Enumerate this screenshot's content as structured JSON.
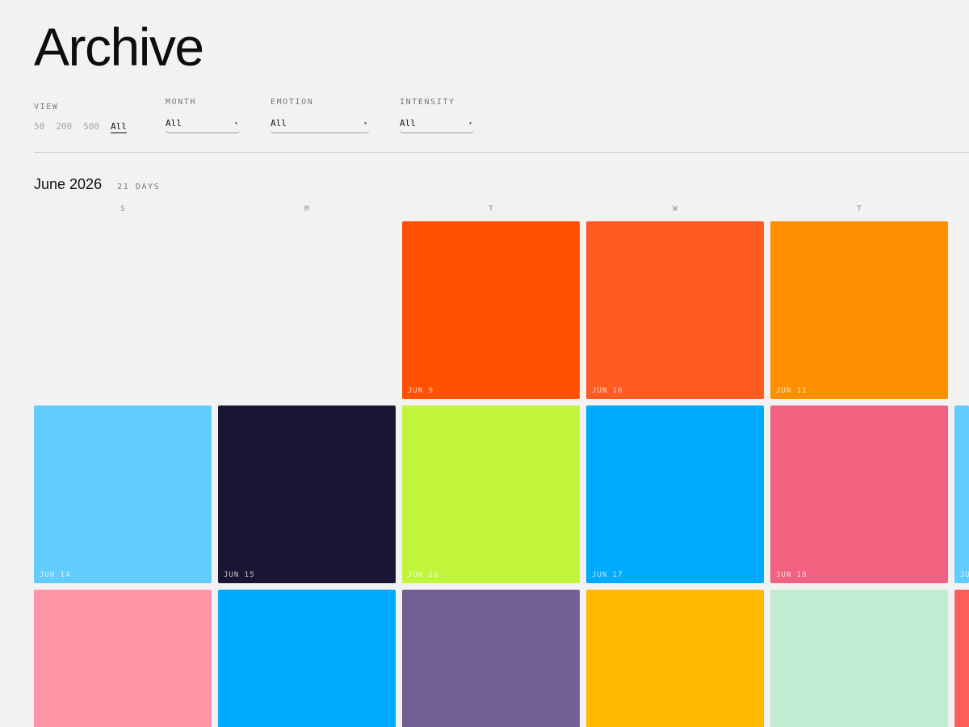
{
  "page": {
    "title": "Archive"
  },
  "filters": {
    "view": {
      "label": "VIEW",
      "options": [
        "50",
        "200",
        "500",
        "All"
      ],
      "selected": "All"
    },
    "month": {
      "label": "MONTH",
      "value": "All"
    },
    "emotion": {
      "label": "EMOTION",
      "value": "All"
    },
    "intensity": {
      "label": "INTENSITY",
      "value": "All"
    }
  },
  "calendar": {
    "month_title": "June 2026",
    "day_count": "21 DAYS",
    "weekdays": [
      "S",
      "M",
      "T",
      "W",
      "T"
    ],
    "tiles": [
      {
        "date": "JUN 9",
        "color": "#ff5100"
      },
      {
        "date": "JUN 10",
        "color": "#ff5a20"
      },
      {
        "date": "JUN 11",
        "color": "#ff8f00"
      },
      {
        "date": "JUN 14",
        "color": "#62ccff"
      },
      {
        "date": "JUN 15",
        "color": "#181632"
      },
      {
        "date": "JUN 16",
        "color": "#c0f53b"
      },
      {
        "date": "JUN 17",
        "color": "#00aaff"
      },
      {
        "date": "JUN 18",
        "color": "#f26180"
      },
      {
        "date": "JUN",
        "color": "#62ccff"
      },
      {
        "date": "",
        "color": "#ff95a7"
      },
      {
        "date": "",
        "color": "#00aaff"
      },
      {
        "date": "",
        "color": "#715f93"
      },
      {
        "date": "",
        "color": "#ffb900"
      },
      {
        "date": "",
        "color": "#c2ecd2"
      },
      {
        "date": "",
        "color": "#ff5f5a"
      }
    ]
  }
}
